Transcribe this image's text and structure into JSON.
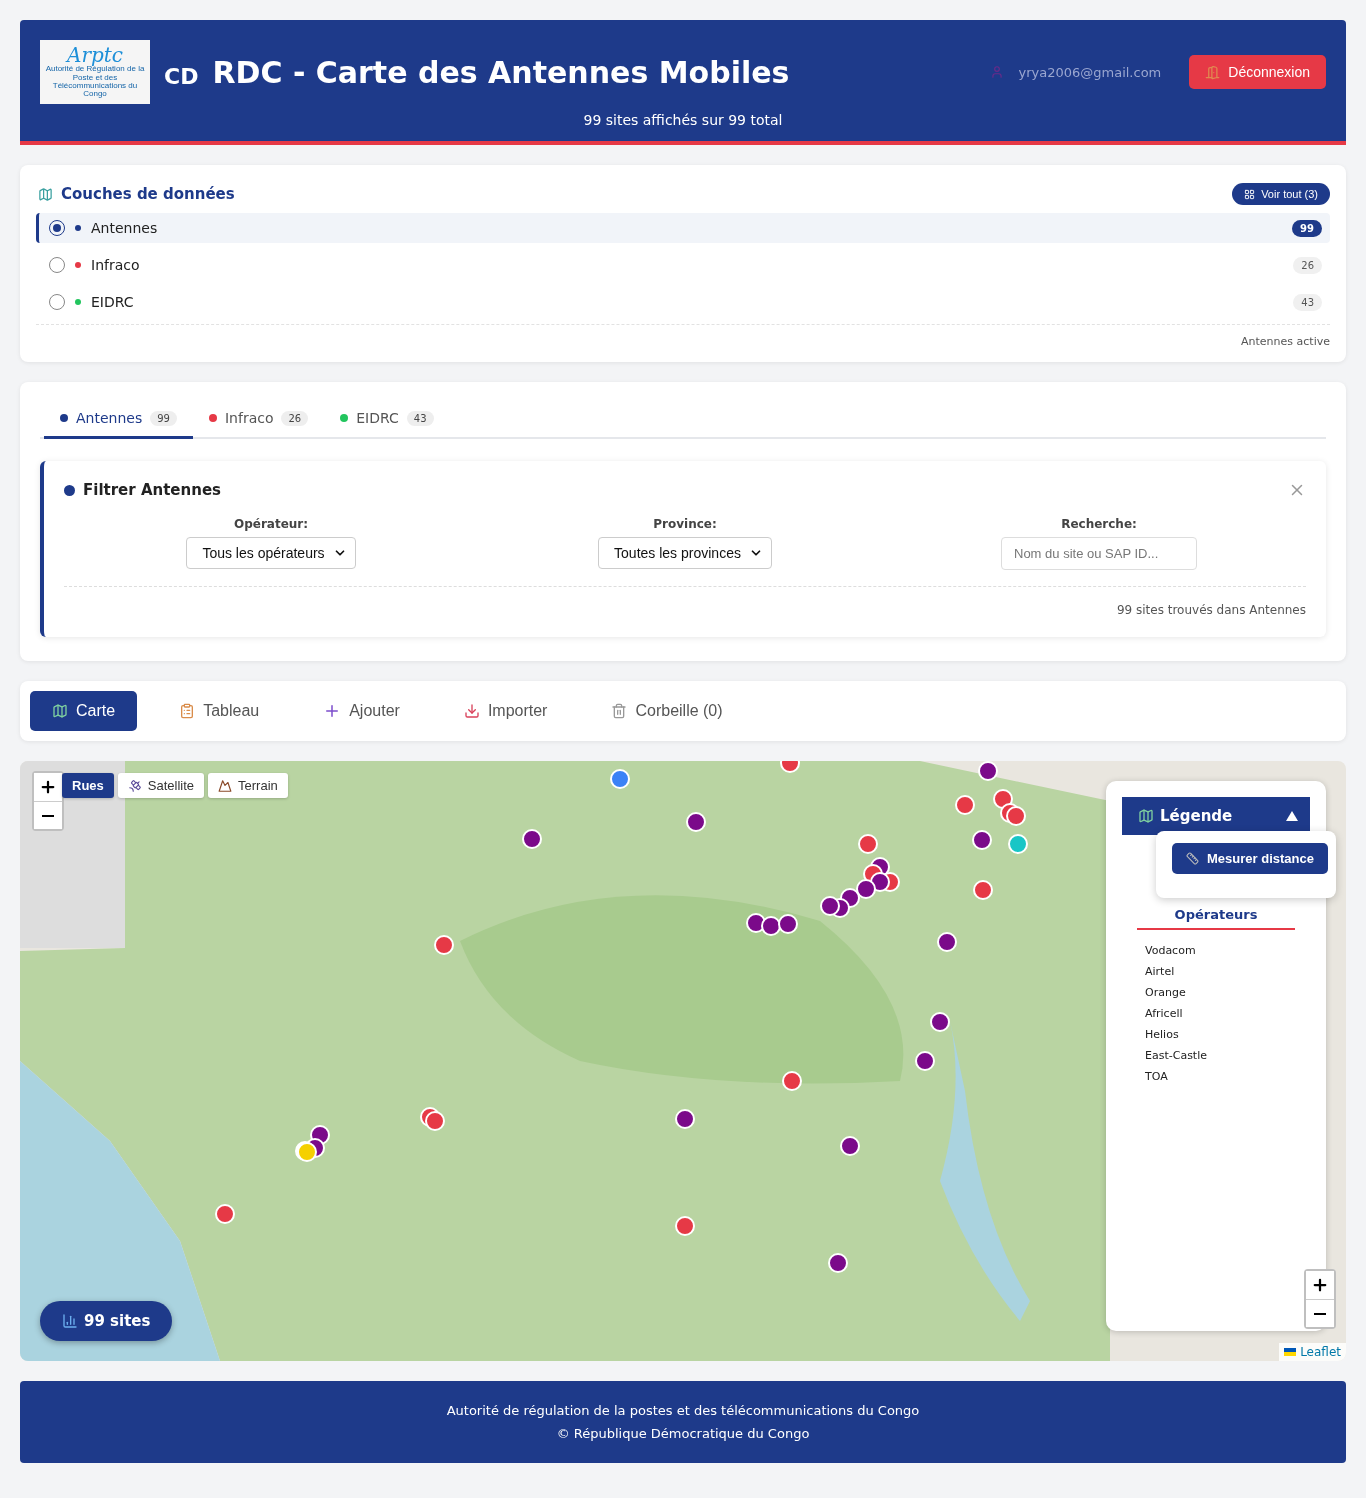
{
  "header": {
    "logo_text": "Arptc",
    "logo_caption": "Autorité de Régulation de la Poste et des Télécommunications du Congo",
    "flag": "CD",
    "title": "RDC - Carte des Antennes Mobiles",
    "subtitle": "99 sites affichés sur 99 total",
    "user_email": "yrya2006@gmail.com",
    "logout_button": "Déconnexion"
  },
  "layers": {
    "title": "Couches de données",
    "show_all_button": "Voir tout (3)",
    "items": [
      {
        "label": "Antennes",
        "count": "99",
        "color": "#1e3a8a",
        "selected": true
      },
      {
        "label": "Infraco",
        "count": "26",
        "color": "#e63946",
        "selected": false
      },
      {
        "label": "EIDRC",
        "count": "43",
        "color": "#22c55e",
        "selected": false
      }
    ],
    "status": "Antennes active"
  },
  "filter_tabs": [
    {
      "label": "Antennes",
      "count": "99",
      "color": "#1e3a8a",
      "selected": true
    },
    {
      "label": "Infraco",
      "count": "26",
      "color": "#e63946",
      "selected": false
    },
    {
      "label": "EIDRC",
      "count": "43",
      "color": "#22c55e",
      "selected": false
    }
  ],
  "filter": {
    "title": "Filtrer Antennes",
    "fields": [
      {
        "kind": "select",
        "label": "Opérateur:",
        "value": "Tous les opérateurs"
      },
      {
        "kind": "select",
        "label": "Province:",
        "value": "Toutes les provinces"
      },
      {
        "kind": "input",
        "label": "Recherche:",
        "placeholder": "Nom du site ou SAP ID..."
      }
    ],
    "result": "99 sites trouvés dans Antennes"
  },
  "nav_tabs": [
    {
      "kind": "map",
      "label": "Carte",
      "selected": true
    },
    {
      "kind": "table",
      "label": "Tableau",
      "selected": false
    },
    {
      "kind": "add",
      "label": "Ajouter",
      "selected": false
    },
    {
      "kind": "import",
      "label": "Importer",
      "selected": false
    },
    {
      "kind": "trash",
      "label": "Corbeille (0)",
      "selected": false
    }
  ],
  "map": {
    "base_layers": [
      {
        "kind": "streets",
        "label": "Rues",
        "selected": true
      },
      {
        "kind": "satellite",
        "label": "Satellite",
        "selected": false
      },
      {
        "kind": "terrain",
        "label": "Terrain",
        "selected": false
      }
    ],
    "legend": {
      "title": "Légende",
      "expanded": true,
      "measure_button": "Mesurer distance",
      "section_title": "Opérateurs",
      "operators": [
        "Vodacom",
        "Airtel",
        "Orange",
        "Africell",
        "Helios",
        "East-Castle",
        "TOA"
      ]
    },
    "site_count": "99 sites",
    "attribution": "Leaflet"
  },
  "footer": {
    "lines": [
      "Autorité de régulation de la postes et des télécommunications du Congo",
      "© République Démocratique du Congo"
    ]
  }
}
